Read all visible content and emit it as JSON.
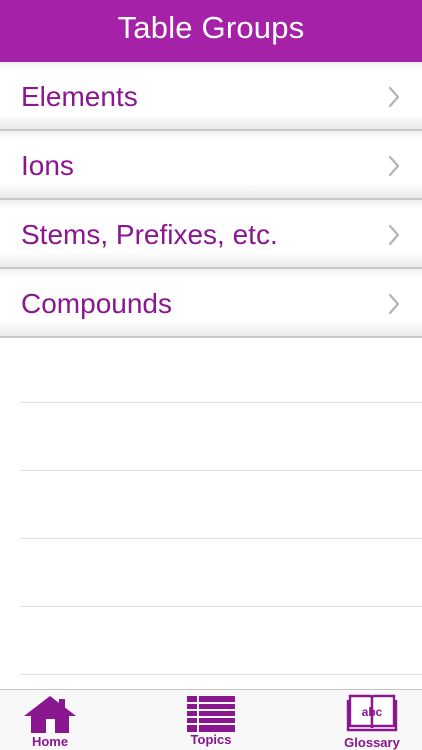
{
  "nav": {
    "title": "Table Groups"
  },
  "list": {
    "items": [
      {
        "label": "Elements"
      },
      {
        "label": "Ions"
      },
      {
        "label": "Stems, Prefixes, etc."
      },
      {
        "label": "Compounds"
      }
    ]
  },
  "tabs": {
    "home_label": "Home",
    "topics_label": "Topics",
    "glossary_label": "Glossary",
    "glossary_icon_text": "abc"
  },
  "colors": {
    "accent": "#a421a8",
    "text": "#8a1690"
  }
}
